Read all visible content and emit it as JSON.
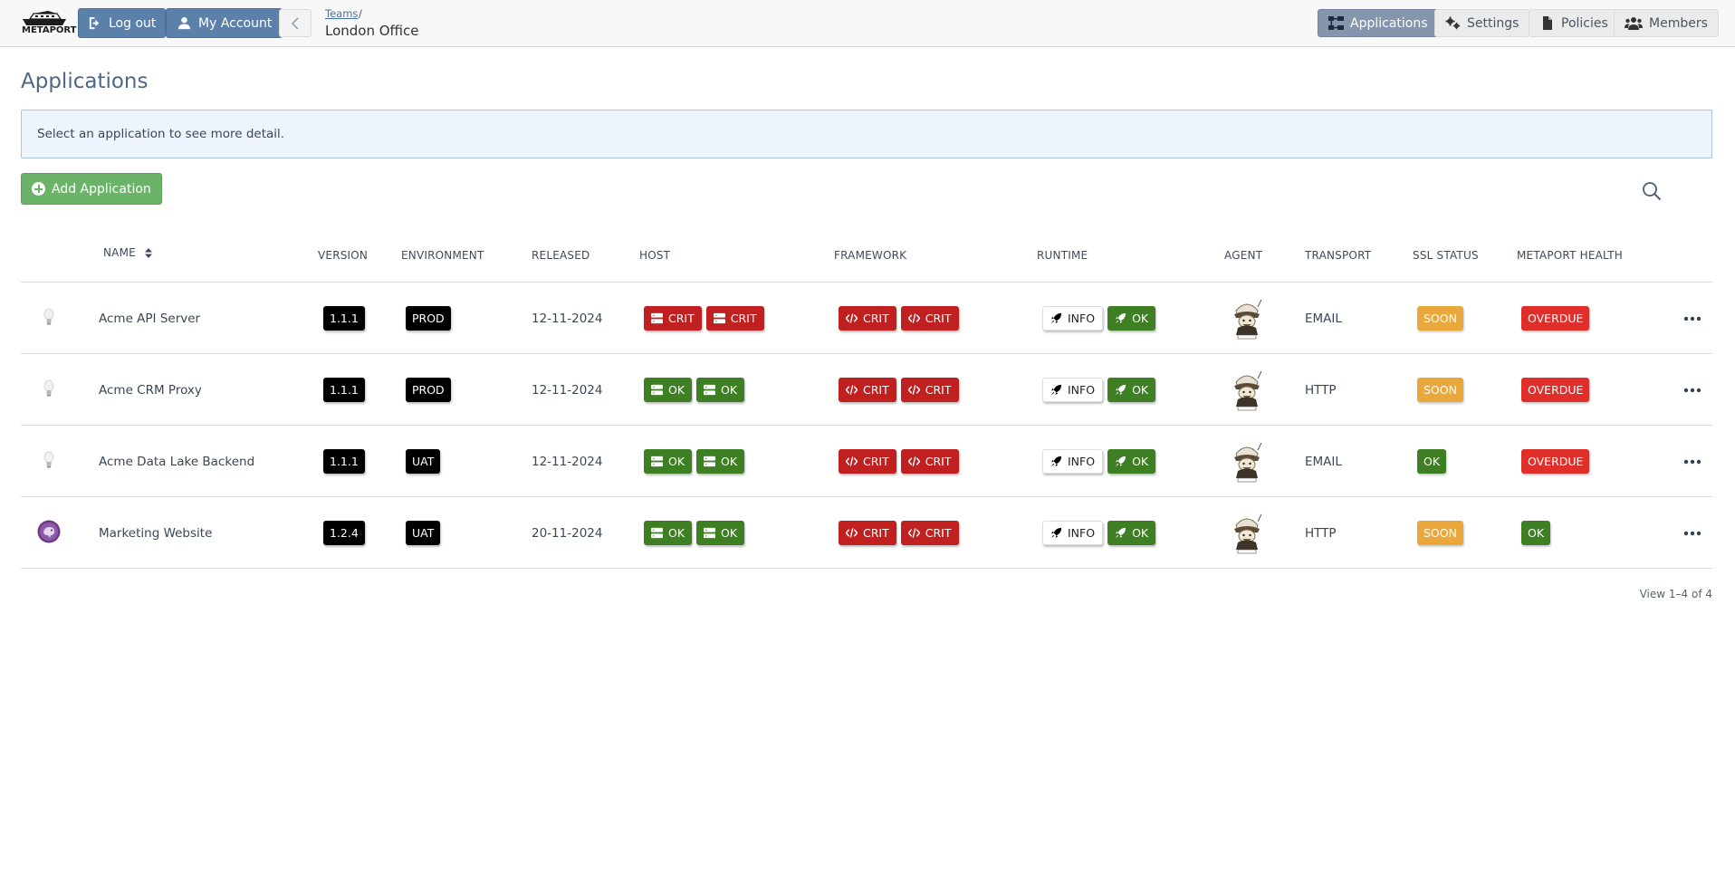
{
  "logo": {
    "text": "METAPORT"
  },
  "header": {
    "logout_label": "Log out",
    "account_label": "My Account",
    "breadcrumb_parent": "Teams",
    "breadcrumb_sep": "/",
    "breadcrumb_current": "London Office"
  },
  "nav": [
    {
      "label": "Applications",
      "icon": "sitemap-icon",
      "active": true
    },
    {
      "label": "Settings",
      "icon": "gears-icon",
      "active": false
    },
    {
      "label": "Policies",
      "icon": "file-icon",
      "active": false
    },
    {
      "label": "Members",
      "icon": "users-icon",
      "active": false
    }
  ],
  "page": {
    "title": "Applications",
    "info": "Select an application to see more detail.",
    "add_label": "Add Application"
  },
  "table": {
    "headers": {
      "name": "NAME",
      "version": "VERSION",
      "environment": "ENVIRONMENT",
      "released": "RELEASED",
      "host": "HOST",
      "framework": "FRAMEWORK",
      "runtime": "RUNTIME",
      "agent": "AGENT",
      "transport": "TRANSPORT",
      "ssl": "SSL STATUS",
      "health": "METAPORT HEALTH"
    },
    "rows": [
      {
        "icon": "lightbulb-icon",
        "name": "Acme API Server",
        "version": "1.1.1",
        "environment": "PROD",
        "released": "12-11-2024",
        "host": [
          "CRIT",
          "CRIT"
        ],
        "framework": [
          "CRIT",
          "CRIT"
        ],
        "runtime": [
          "INFO",
          "OK"
        ],
        "transport": "EMAIL",
        "ssl": "SOON",
        "health": "OVERDUE"
      },
      {
        "icon": "lightbulb-icon",
        "name": "Acme CRM Proxy",
        "version": "1.1.1",
        "environment": "PROD",
        "released": "12-11-2024",
        "host": [
          "OK",
          "OK"
        ],
        "framework": [
          "CRIT",
          "CRIT"
        ],
        "runtime": [
          "INFO",
          "OK"
        ],
        "transport": "HTTP",
        "ssl": "SOON",
        "health": "OVERDUE"
      },
      {
        "icon": "lightbulb-icon",
        "name": "Acme Data Lake Backend",
        "version": "1.1.1",
        "environment": "UAT",
        "released": "12-11-2024",
        "host": [
          "OK",
          "OK"
        ],
        "framework": [
          "CRIT",
          "CRIT"
        ],
        "runtime": [
          "INFO",
          "OK"
        ],
        "transport": "EMAIL",
        "ssl": "OK",
        "health": "OVERDUE"
      },
      {
        "icon": "php-elephant-icon",
        "name": "Marketing Website",
        "version": "1.2.4",
        "environment": "UAT",
        "released": "20-11-2024",
        "host": [
          "OK",
          "OK"
        ],
        "framework": [
          "CRIT",
          "CRIT"
        ],
        "runtime": [
          "INFO",
          "OK"
        ],
        "transport": "HTTP",
        "ssl": "SOON",
        "health": "OK"
      }
    ]
  },
  "pager": "View 1–4 of 4",
  "colors": {
    "crit": "#c0201f",
    "ok": "#3e7f24",
    "soon": "#e9a73c",
    "overdue": "#e02e2b",
    "primary": "#5b80aa",
    "add": "#6cb36a"
  }
}
